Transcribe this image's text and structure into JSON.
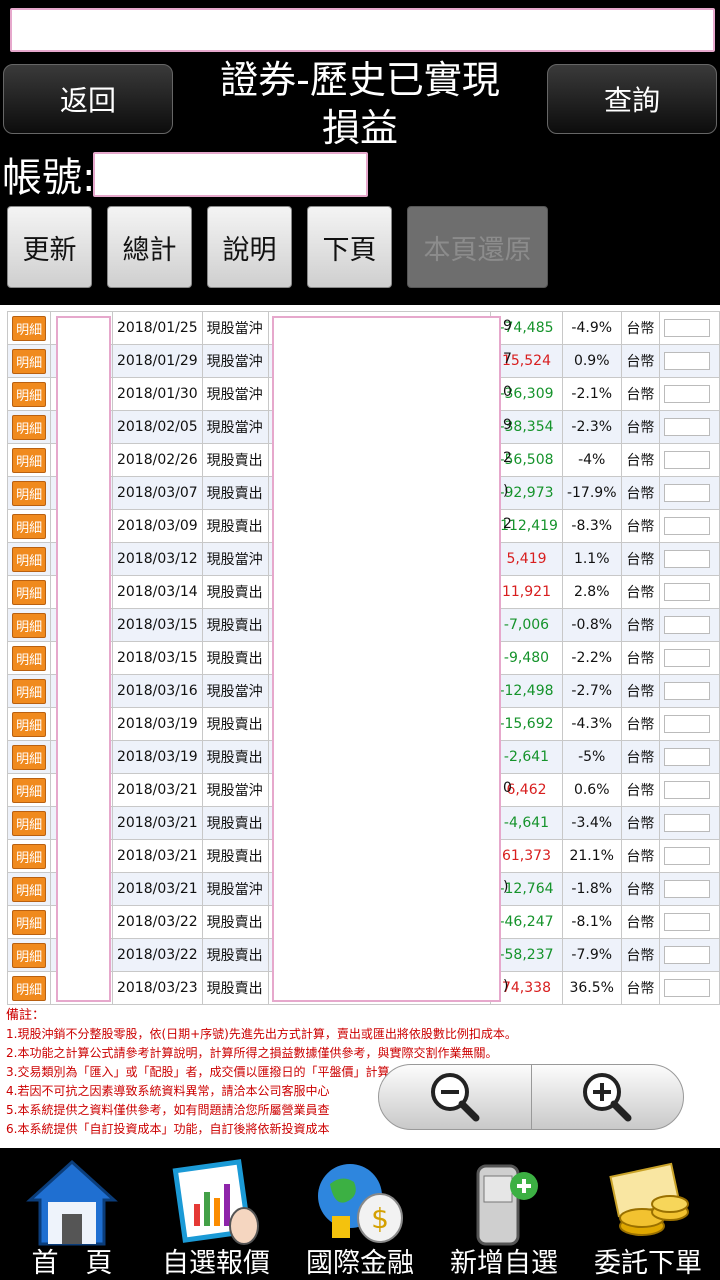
{
  "header": {
    "title_line1": "證券-歷史已實現",
    "title_line2": "損益",
    "back_label": "返回",
    "query_label": "查詢",
    "account_label": "帳號:"
  },
  "toolbar": {
    "refresh": "更新",
    "total": "總計",
    "help": "說明",
    "next_page": "下頁",
    "restore": "本頁還原"
  },
  "table": {
    "detail_label": "明細",
    "rows": [
      {
        "date": "2018/01/25",
        "type": "現股當沖",
        "peek": "9",
        "amount": "-74,485",
        "pct": "-4.9%",
        "currency": "台幣",
        "sign": "neg"
      },
      {
        "date": "2018/01/29",
        "type": "現股當沖",
        "peek": "7",
        "amount": "15,524",
        "pct": "0.9%",
        "currency": "台幣",
        "sign": "pos"
      },
      {
        "date": "2018/01/30",
        "type": "現股當沖",
        "peek": "0",
        "amount": "-36,309",
        "pct": "-2.1%",
        "currency": "台幣",
        "sign": "neg"
      },
      {
        "date": "2018/02/05",
        "type": "現股當沖",
        "peek": "9",
        "amount": "-38,354",
        "pct": "-2.3%",
        "currency": "台幣",
        "sign": "neg"
      },
      {
        "date": "2018/02/26",
        "type": "現股賣出",
        "peek": "2",
        "amount": "-56,508",
        "pct": "-4%",
        "currency": "台幣",
        "sign": "neg"
      },
      {
        "date": "2018/03/07",
        "type": "現股賣出",
        "peek": ")",
        "amount": "-92,973",
        "pct": "-17.9%",
        "currency": "台幣",
        "sign": "neg"
      },
      {
        "date": "2018/03/09",
        "type": "現股賣出",
        "peek": "2",
        "amount": "-112,419",
        "pct": "-8.3%",
        "currency": "台幣",
        "sign": "neg"
      },
      {
        "date": "2018/03/12",
        "type": "現股當沖",
        "peek": "",
        "amount": "5,419",
        "pct": "1.1%",
        "currency": "台幣",
        "sign": "pos"
      },
      {
        "date": "2018/03/14",
        "type": "現股賣出",
        "peek": "",
        "amount": "11,921",
        "pct": "2.8%",
        "currency": "台幣",
        "sign": "pos"
      },
      {
        "date": "2018/03/15",
        "type": "現股賣出",
        "peek": "",
        "amount": "-7,006",
        "pct": "-0.8%",
        "currency": "台幣",
        "sign": "neg"
      },
      {
        "date": "2018/03/15",
        "type": "現股賣出",
        "peek": "",
        "amount": "-9,480",
        "pct": "-2.2%",
        "currency": "台幣",
        "sign": "neg"
      },
      {
        "date": "2018/03/16",
        "type": "現股當沖",
        "peek": "",
        "amount": "-12,498",
        "pct": "-2.7%",
        "currency": "台幣",
        "sign": "neg"
      },
      {
        "date": "2018/03/19",
        "type": "現股賣出",
        "peek": "",
        "amount": "-15,692",
        "pct": "-4.3%",
        "currency": "台幣",
        "sign": "neg"
      },
      {
        "date": "2018/03/19",
        "type": "現股賣出",
        "peek": "",
        "amount": "-2,641",
        "pct": "-5%",
        "currency": "台幣",
        "sign": "neg"
      },
      {
        "date": "2018/03/21",
        "type": "現股當沖",
        "peek": "0",
        "amount": "6,462",
        "pct": "0.6%",
        "currency": "台幣",
        "sign": "pos"
      },
      {
        "date": "2018/03/21",
        "type": "現股賣出",
        "peek": "",
        "amount": "-4,641",
        "pct": "-3.4%",
        "currency": "台幣",
        "sign": "neg"
      },
      {
        "date": "2018/03/21",
        "type": "現股賣出",
        "peek": "",
        "amount": "61,373",
        "pct": "21.1%",
        "currency": "台幣",
        "sign": "pos"
      },
      {
        "date": "2018/03/21",
        "type": "現股當沖",
        "peek": ")",
        "amount": "-12,764",
        "pct": "-1.8%",
        "currency": "台幣",
        "sign": "neg"
      },
      {
        "date": "2018/03/22",
        "type": "現股賣出",
        "peek": "",
        "amount": "-46,247",
        "pct": "-8.1%",
        "currency": "台幣",
        "sign": "neg"
      },
      {
        "date": "2018/03/22",
        "type": "現股賣出",
        "peek": "",
        "amount": "-58,237",
        "pct": "-7.9%",
        "currency": "台幣",
        "sign": "neg"
      },
      {
        "date": "2018/03/23",
        "type": "現股賣出",
        "peek": ")",
        "amount": "74,338",
        "pct": "36.5%",
        "currency": "台幣",
        "sign": "pos"
      }
    ]
  },
  "notes": {
    "title": "備註：",
    "lines": [
      "1.現股沖銷不分整股零股，依(日期+序號)先進先出方式計算，賣出或匯出將依股數比例扣成本。",
      "2.本功能之計算公式請參考計算說明，計算所得之損益數據僅供參考，與實際交割作業無關。",
      "3.交易類別為「匯入」或「配股」者，成交價以匯撥日的「平盤價」計算。",
      "4.若因不可抗之因素導致系統資料異常，請洽本公司客服中心",
      "5.本系統提供之資料僅供參考，如有問題請洽您所屬營業員查",
      "6.本系統提供「自訂投資成本」功能，自訂後將依新投資成本"
    ]
  },
  "zoom": {
    "out_icon": "zoom-out-icon",
    "in_icon": "zoom-in-icon"
  },
  "bottom_nav": [
    {
      "label": "首　頁",
      "icon": "home-icon"
    },
    {
      "label": "自選報價",
      "icon": "chart-board-icon"
    },
    {
      "label": "國際金融",
      "icon": "globe-money-icon"
    },
    {
      "label": "新增自選",
      "icon": "phone-add-icon"
    },
    {
      "label": "委託下單",
      "icon": "coins-order-icon"
    }
  ]
}
